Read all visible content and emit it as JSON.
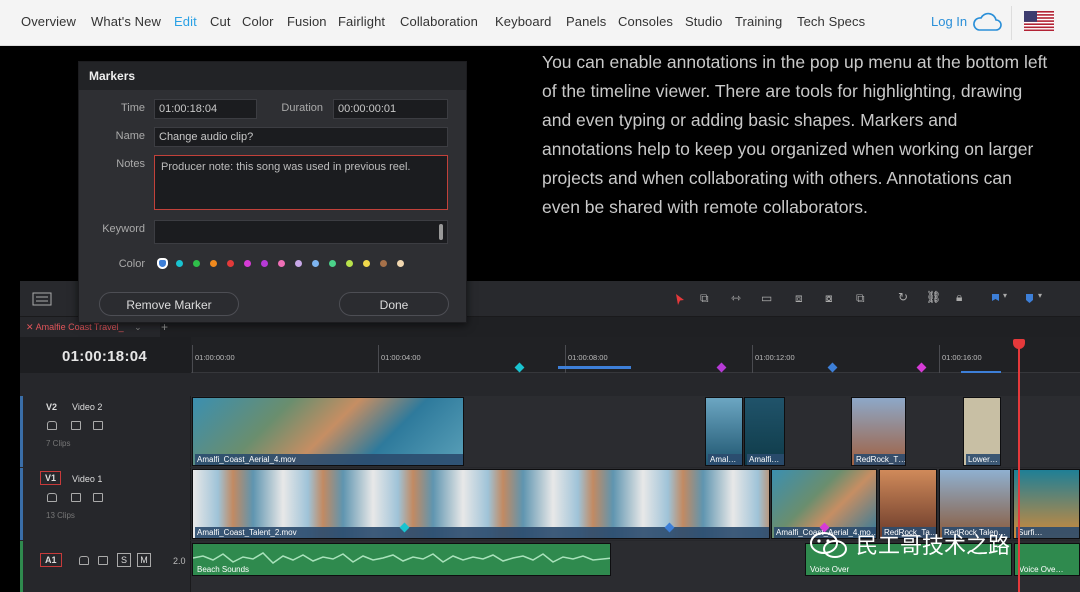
{
  "nav": {
    "items": [
      "Overview",
      "What's New",
      "Edit",
      "Cut",
      "Color",
      "Fusion",
      "Fairlight",
      "Collaboration",
      "Keyboard",
      "Panels",
      "Consoles",
      "Studio",
      "Training",
      "Tech Specs"
    ],
    "active": "Edit",
    "login": "Log In"
  },
  "description": "You can enable annotations in the pop up menu at the bottom left of the timeline viewer. There are tools for highlighting, drawing and even typing or adding basic shapes. Markers and annotations help to keep you organized when working on larger projects and when collaborating with others. Annotations can even be shared with remote collaborators.",
  "dialog": {
    "title": "Markers",
    "time_label": "Time",
    "time_value": "01:00:18:04",
    "duration_label": "Duration",
    "duration_value": "00:00:00:01",
    "name_label": "Name",
    "name_value": "Change audio clip?",
    "notes_label": "Notes",
    "notes_value": "Producer note: this song was used in previous reel.",
    "keyword_label": "Keyword",
    "keyword_value": "",
    "color_label": "Color",
    "colors": [
      "#3d7fd8",
      "#19c3d0",
      "#2fbf4a",
      "#f08a1e",
      "#e33a3a",
      "#d63bd6",
      "#b63ad6",
      "#ef6fb6",
      "#c8a8e8",
      "#7db4f0",
      "#4bd28a",
      "#b8e24b",
      "#f0d84b",
      "#a6714a",
      "#f1d7b0"
    ],
    "remove_button": "Remove Marker",
    "done_button": "Done"
  },
  "timeline": {
    "tab_label": "Amalfie Coast Travel_",
    "timecode": "01:00:18:04",
    "ruler_labels": [
      "01:00:00:00",
      "01:00:04:00",
      "01:00:08:00",
      "01:00:12:00",
      "01:00:16:00"
    ],
    "tracks": [
      {
        "id": "V2",
        "name": "Video 2",
        "clips": "7 Clips"
      },
      {
        "id": "V1",
        "name": "Video 1",
        "clips": "13 Clips"
      },
      {
        "id": "A1",
        "name": "",
        "level": "2.0",
        "buttons": [
          "S",
          "M"
        ]
      }
    ],
    "v2_clips": [
      "Amalfi_Coast_Aerial_4.mov",
      "Amal…",
      "Amalfi…",
      "RedRock_T…",
      "Lower…"
    ],
    "v1_clips": [
      "Amalfi_Coast_Talent_2.mov",
      "Amalfi_Coast_Aerial_4.mo…",
      "RedRock_Ta…",
      "RedRock Talen…",
      "Surfi…"
    ],
    "a1_clips": [
      "Beach Sounds",
      "Voice Over",
      "Voice Ove…"
    ]
  },
  "watermark": "民工哥技术之路",
  "colors": {
    "accent": "#2aa1e5",
    "playhead": "#e5393b",
    "notes_border": "#c2413a"
  }
}
